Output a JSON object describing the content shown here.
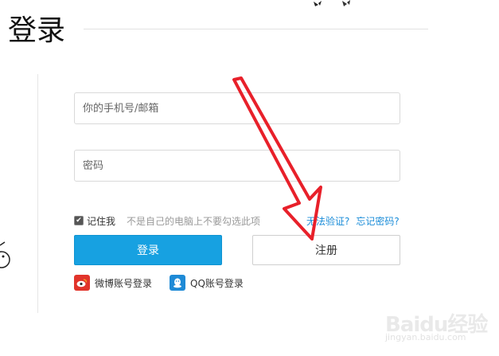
{
  "page": {
    "title": "登录"
  },
  "form": {
    "account_placeholder": "你的手机号/邮箱",
    "password_placeholder": "密码",
    "remember_label": "记住我",
    "remember_checked": true,
    "remember_hint": "不是自己的电脑上不要勾选此项",
    "cannot_verify_link": "无法验证?",
    "forgot_password_link": "忘记密码?",
    "login_button": "登录",
    "register_button": "注册"
  },
  "social": {
    "weibo_label": "微博账号登录",
    "qq_label": "QQ账号登录"
  },
  "watermark": {
    "brand": "Baidu经验",
    "url": "jingyan.baidu.com"
  },
  "colors": {
    "primary": "#17a1e1",
    "link": "#1a8cd8",
    "annotation_arrow": "#e8202a",
    "weibo": "#e1342b",
    "qq": "#1e8ad6"
  },
  "icons": [
    "weibo-icon",
    "qq-icon",
    "checkbox-check-icon"
  ]
}
